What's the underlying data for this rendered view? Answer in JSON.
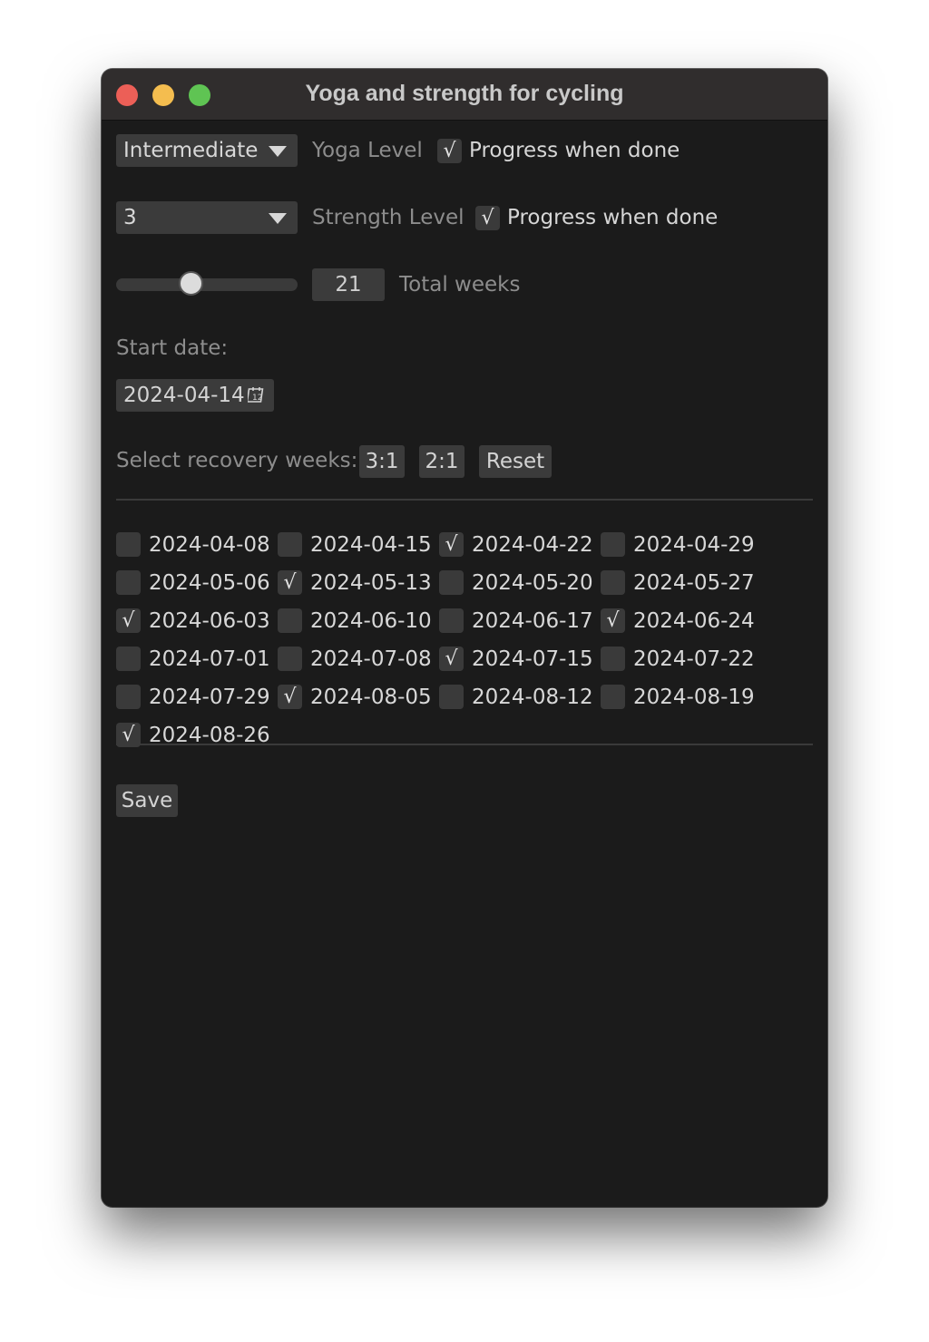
{
  "window": {
    "title": "Yoga and strength for cycling"
  },
  "yoga": {
    "level_value": "Intermediate",
    "label": "Yoga Level",
    "progress_checked": true,
    "progress_label": "Progress when done"
  },
  "strength": {
    "level_value": "3",
    "label": "Strength Level",
    "progress_checked": true,
    "progress_label": "Progress when done"
  },
  "weeks": {
    "slider_fraction": 0.4,
    "value": "21",
    "label": "Total weeks"
  },
  "start": {
    "label": "Start date:",
    "date": "2024-04-14",
    "calendar_icon": "calendar-icon"
  },
  "recovery": {
    "label": "Select recovery weeks:",
    "buttons": [
      "3:1",
      "2:1",
      "Reset"
    ],
    "weeks": [
      {
        "date": "2024-04-08",
        "checked": false
      },
      {
        "date": "2024-04-15",
        "checked": false
      },
      {
        "date": "2024-04-22",
        "checked": true
      },
      {
        "date": "2024-04-29",
        "checked": false
      },
      {
        "date": "2024-05-06",
        "checked": false
      },
      {
        "date": "2024-05-13",
        "checked": true
      },
      {
        "date": "2024-05-20",
        "checked": false
      },
      {
        "date": "2024-05-27",
        "checked": false
      },
      {
        "date": "2024-06-03",
        "checked": true
      },
      {
        "date": "2024-06-10",
        "checked": false
      },
      {
        "date": "2024-06-17",
        "checked": false
      },
      {
        "date": "2024-06-24",
        "checked": true
      },
      {
        "date": "2024-07-01",
        "checked": false
      },
      {
        "date": "2024-07-08",
        "checked": false
      },
      {
        "date": "2024-07-15",
        "checked": true
      },
      {
        "date": "2024-07-22",
        "checked": false
      },
      {
        "date": "2024-07-29",
        "checked": false
      },
      {
        "date": "2024-08-05",
        "checked": true
      },
      {
        "date": "2024-08-12",
        "checked": false
      },
      {
        "date": "2024-08-19",
        "checked": false
      },
      {
        "date": "2024-08-26",
        "checked": true
      }
    ]
  },
  "save_label": "Save",
  "colors": {
    "window_bg": "#1b1b1b",
    "titlebar_bg": "#302d2d",
    "control_bg": "#3b3b3b",
    "close": "#ec5f57",
    "minimize": "#f4bd4f",
    "maximize": "#5fc453"
  }
}
